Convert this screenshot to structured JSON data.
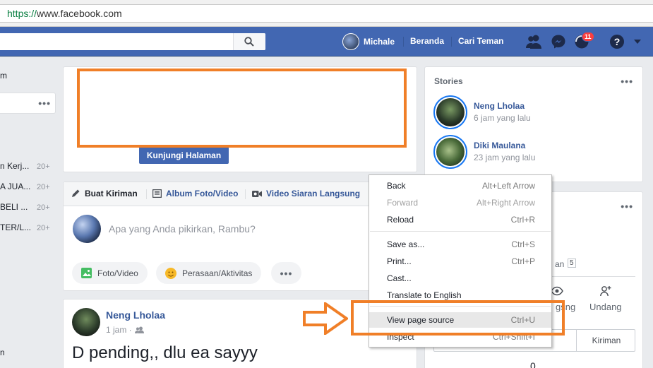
{
  "browser": {
    "scheme": "https://",
    "host": "www.facebook.com"
  },
  "header": {
    "user_name": "Michale",
    "home_label": "Beranda",
    "find_friends_label": "Cari Teman",
    "notification_count": "11",
    "brand_color": "#4267b2"
  },
  "left": {
    "items": [
      {
        "label": "m",
        "count": ""
      },
      {
        "label": "n Kerj...",
        "count": "20+"
      },
      {
        "label": "A JUA...",
        "count": "20+"
      },
      {
        "label": "BELI ...",
        "count": "20+"
      },
      {
        "label": "TER/L...",
        "count": "20+"
      },
      {
        "label": "n",
        "count": ""
      }
    ]
  },
  "page_card": {
    "visit_label": "Kunjungi Halaman"
  },
  "compose": {
    "tab_create": "Buat Kiriman",
    "tab_album": "Album Foto/Video",
    "tab_live": "Video Siaran Langsung",
    "placeholder": "Apa yang Anda pikirkan, Rambu?",
    "photo_video": "Foto/Video",
    "feeling": "Perasaan/Aktivitas"
  },
  "post": {
    "author": "Neng Lholaa",
    "time": "1 jam ·",
    "text": "D pending,, dlu ea sayyy"
  },
  "stories": {
    "title": "Stories",
    "items": [
      {
        "name": "Neng Lholaa",
        "time": "6 jam yang lalu"
      },
      {
        "name": "Diki Maulana",
        "time": "23 jam yang lalu"
      }
    ]
  },
  "right_card": {
    "frag_an": "an",
    "frag_num": "5",
    "frag_gsng": "gsng",
    "invite_label": "Undang",
    "tab_posts": "Kiriman",
    "zero": "0"
  },
  "context_menu": {
    "items": [
      {
        "label": "Back",
        "shortcut": "Alt+Left Arrow"
      },
      {
        "label": "Forward",
        "shortcut": "Alt+Right Arrow"
      },
      {
        "label": "Reload",
        "shortcut": "Ctrl+R"
      },
      {
        "label": "Save as...",
        "shortcut": "Ctrl+S"
      },
      {
        "label": "Print...",
        "shortcut": "Ctrl+P"
      },
      {
        "label": "Cast...",
        "shortcut": ""
      },
      {
        "label": "Translate to English",
        "shortcut": ""
      },
      {
        "label": "View page source",
        "shortcut": "Ctrl+U"
      },
      {
        "label": "Inspect",
        "shortcut": "Ctrl+Shift+I"
      }
    ]
  },
  "annotation_color": "#f07f28"
}
